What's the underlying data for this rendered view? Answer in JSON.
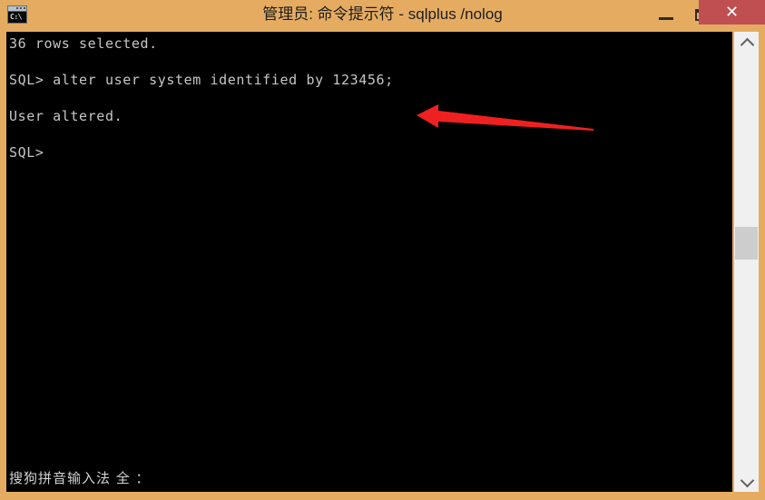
{
  "window": {
    "title": "管理员: 命令提示符 - sqlplus  /nolog",
    "icon_name": "command-prompt-icon",
    "icon_text": "C:\\",
    "colors": {
      "titlebar": "#e5ac61",
      "close_button": "#c04f52",
      "console_background": "#000000",
      "console_text": "#c6c6c6",
      "annotation_arrow": "#f02020",
      "scrollbar_track": "#f0f0f0",
      "scrollbar_thumb": "#cdcdcd"
    },
    "controls": {
      "minimize_label": "—",
      "maximize_label": "❐",
      "close_label": "✕"
    }
  },
  "console": {
    "lines": [
      "36 rows selected.",
      "",
      "SQL> alter user system identified by 123456;",
      "",
      "User altered.",
      "",
      "SQL>"
    ],
    "text": "36 rows selected.\n\nSQL> alter user system identified by 123456;\n\nUser altered.\n\nSQL>"
  },
  "annotation": {
    "type": "arrow",
    "direction": "left",
    "color": "#f02020",
    "points_to": "end of command line \"SQL> alter user system identified by 123456;\""
  },
  "ime": {
    "status_text": "搜狗拼音输入法 全 ："
  },
  "scrollbar": {
    "up_arrow_icon": "chevron-up-icon",
    "down_arrow_icon": "chevron-down-icon",
    "thumb_position_percent": 44
  }
}
